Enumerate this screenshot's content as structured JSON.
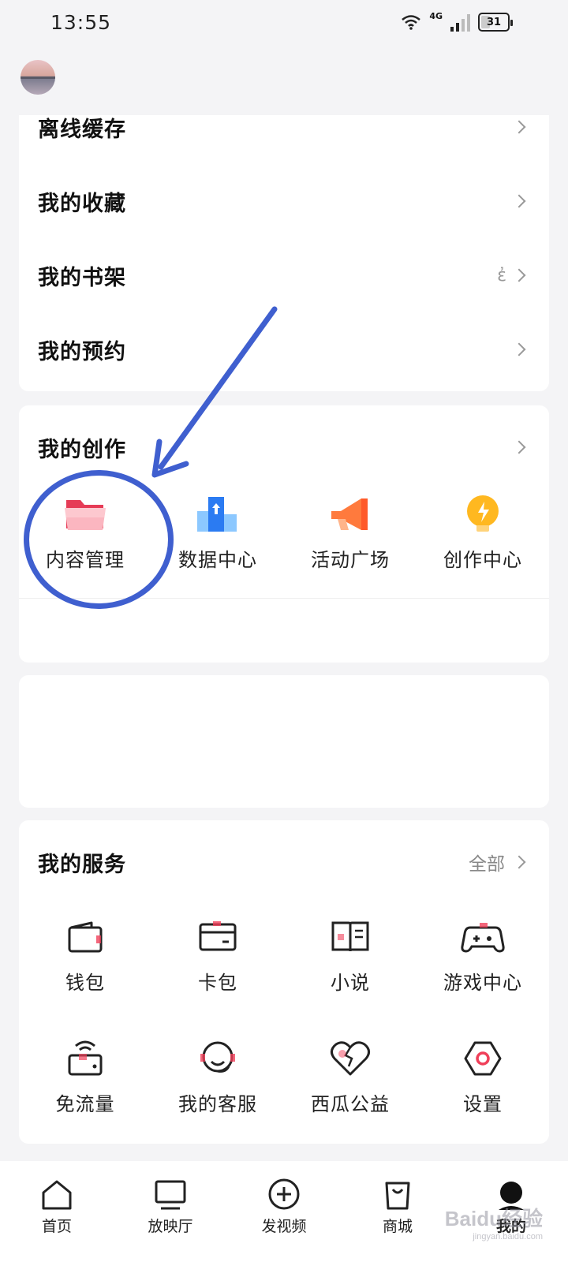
{
  "status_bar": {
    "time": "13:55",
    "network": "4G",
    "battery": "31"
  },
  "menu_list": {
    "items": [
      {
        "label": "离线缓存",
        "extra": ""
      },
      {
        "label": "我的收藏",
        "extra": ""
      },
      {
        "label": "我的书架",
        "extra": "ἐ"
      },
      {
        "label": "我的预约",
        "extra": ""
      }
    ]
  },
  "creation": {
    "title": "我的创作",
    "items": [
      {
        "label": "内容管理",
        "icon": "folder-icon"
      },
      {
        "label": "数据中心",
        "icon": "data-chart-icon"
      },
      {
        "label": "活动广场",
        "icon": "megaphone-icon"
      },
      {
        "label": "创作中心",
        "icon": "lightbulb-icon"
      }
    ]
  },
  "services": {
    "title": "我的服务",
    "more_label": "全部",
    "items": [
      {
        "label": "钱包",
        "icon": "wallet-icon"
      },
      {
        "label": "卡包",
        "icon": "card-icon"
      },
      {
        "label": "小说",
        "icon": "book-icon"
      },
      {
        "label": "游戏中心",
        "icon": "gamepad-icon"
      },
      {
        "label": "免流量",
        "icon": "free-data-icon"
      },
      {
        "label": "我的客服",
        "icon": "headset-icon"
      },
      {
        "label": "西瓜公益",
        "icon": "heart-icon"
      },
      {
        "label": "设置",
        "icon": "settings-hex-icon"
      }
    ]
  },
  "tab_bar": {
    "tabs": [
      {
        "label": "首页",
        "icon": "home-icon"
      },
      {
        "label": "放映厅",
        "icon": "tv-icon"
      },
      {
        "label": "发视频",
        "icon": "plus-circle-icon"
      },
      {
        "label": "商城",
        "icon": "shopping-bag-icon"
      },
      {
        "label": "我的",
        "icon": "profile-icon"
      }
    ]
  },
  "watermark": {
    "text": "Baidu经验",
    "sub": "jingyan.baidu.com"
  },
  "colors": {
    "annotation": "#3f5fcf",
    "accent_red": "#f0405a"
  }
}
